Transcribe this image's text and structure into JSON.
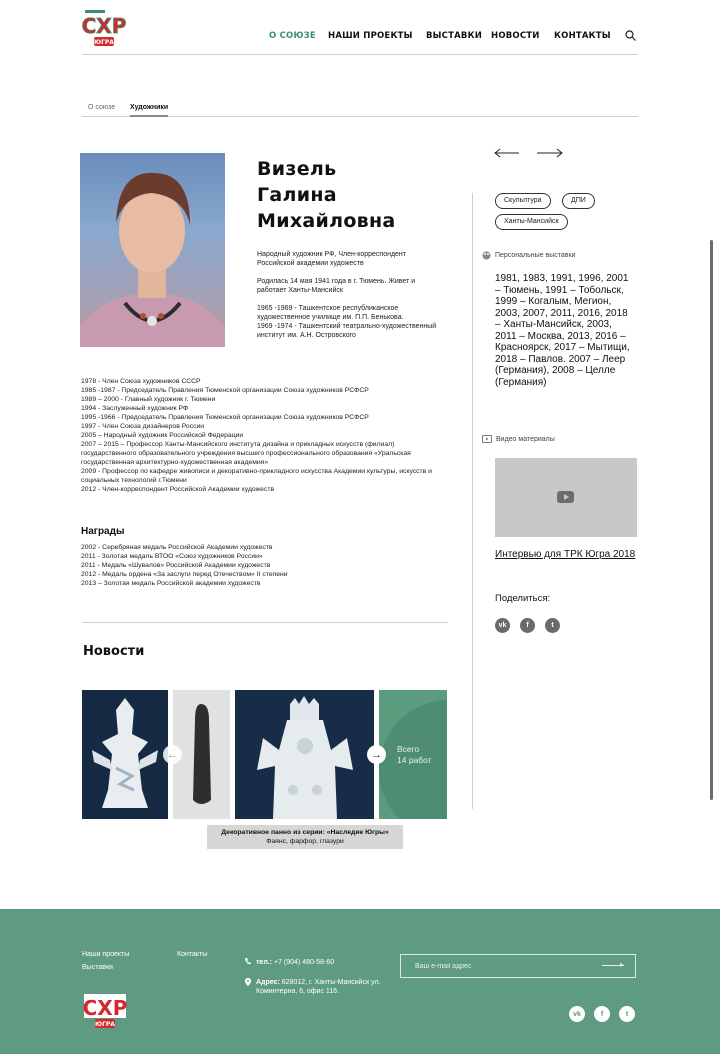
{
  "header": {
    "logo_text": "СХР",
    "logo_sub": "ЮГРА",
    "nav": [
      {
        "label": "О СОЮЗЕ",
        "active": true
      },
      {
        "label": "НАШИ ПРОЕКТЫ",
        "active": false
      },
      {
        "label": "ВЫСТАВКИ",
        "active": false
      },
      {
        "label": "НОВОСТИ",
        "active": false
      },
      {
        "label": "КОНТАКТЫ",
        "active": false
      }
    ]
  },
  "tabs": [
    {
      "label": "О союзе",
      "active": false
    },
    {
      "label": "Художники",
      "active": true
    }
  ],
  "artist": {
    "name_lines": [
      "Визель",
      "Галина",
      "Михайловна"
    ],
    "bio": [
      "Народный художник РФ, Член-корреспондент Российской академии художеств",
      "Родилась 14 мая 1941 года в г. Тюмень. Живет и работает Ханты-Мансийск",
      "1965 -1969  -  Ташкентское республиканское художественное училище им. П.П. Бенькова.\n1969 -1974  -  Ташкентский театрально-художественный институт им. А.Н. Островского"
    ],
    "career": [
      "1978 - Член Союза художников СССР",
      "1985 -1987 -  Председатель Правления Тюменской организации Союза художников РСФСР",
      "1989 – 2000 -  Главный художник г. Тюмени",
      "1994 - Заслуженный художник РФ",
      "1995 -1966 - Председатель Правления Тюменской организации Союза художников РСФСР",
      "1997 - Член Союза дизайнеров России",
      "2005 – Народный художник Российской Федерации",
      "2007 – 2015 – Профессор Ханты-Мансийского института дизайна и прикладных искусств (филиал) государственного образовательного учреждения высшего профессионального образования «Уральская государственная архитектурно-художественная академия»",
      "2009 - Профессор по кафедре живописи и декоративно-прикладного искусства Академии культуры, искусств и социальных технологий г.Тюмени",
      "2012 - Член-корреспондент Российской Академии художеств"
    ],
    "awards_title": "Награды",
    "awards": [
      "2002 - Серебряная медаль Российской Академии художеств",
      "2011 - Золотая медаль ВТОО «Союз художников России»",
      "2011 - Медаль «Шувалов» Российской Академии художеств",
      "2012 - Медаль ордена «За заслуги перед Отечеством» II степени",
      "2013 – Золотая медаль Российской академии художеств"
    ]
  },
  "news": {
    "title": "Новости",
    "total_label": "Всего",
    "total_value": "14 работ",
    "caption_title": "Декоративное панно из серии: «Наследие Югры»",
    "caption_sub": "Фаянс, фарфор, глазури"
  },
  "sidebar": {
    "tags": [
      "Скульптура",
      "ДПИ",
      "Ханты-Мансийск"
    ],
    "exhibitions_label": "Персональные выставки",
    "exhibitions_text": "1981, 1983, 1991, 1996, 2001 – Тюмень, 1991 – Тобольск, 1999 – Когалым, Мегион, 2003, 2007, 2011, 2016, 2018 – Ханты-Мансийск, 2003, 2011 – Москва, 2013, 2016 – Красноярск, 2017 – Мытищи, 2018 – Павлов. 2007 – Леер (Германия), 2008 – Целле (Германия)",
    "video_label": "Видео материалы",
    "video_link": "Интервью для ТРК Югра 2018",
    "share_label": "Поделиться:",
    "social": [
      "vk",
      "f",
      "t"
    ]
  },
  "footer": {
    "links": [
      "Наши проекты",
      "Выставки",
      "Контакты"
    ],
    "phone_label": "тел.:",
    "phone": "+7 (904) 480-58-60",
    "address_label": "Адрес:",
    "address": "628012, г. Ханты-Мансийск ул. Коминтерна, 6, офис 116.",
    "email_placeholder": "Ваш e-mail адрес",
    "logo_text": "СХР",
    "logo_sub": "ЮГРА"
  },
  "colors": {
    "brand_green": "#5f9b80",
    "accent_red": "#d12a2f",
    "nav_active": "#3f8f6f"
  }
}
